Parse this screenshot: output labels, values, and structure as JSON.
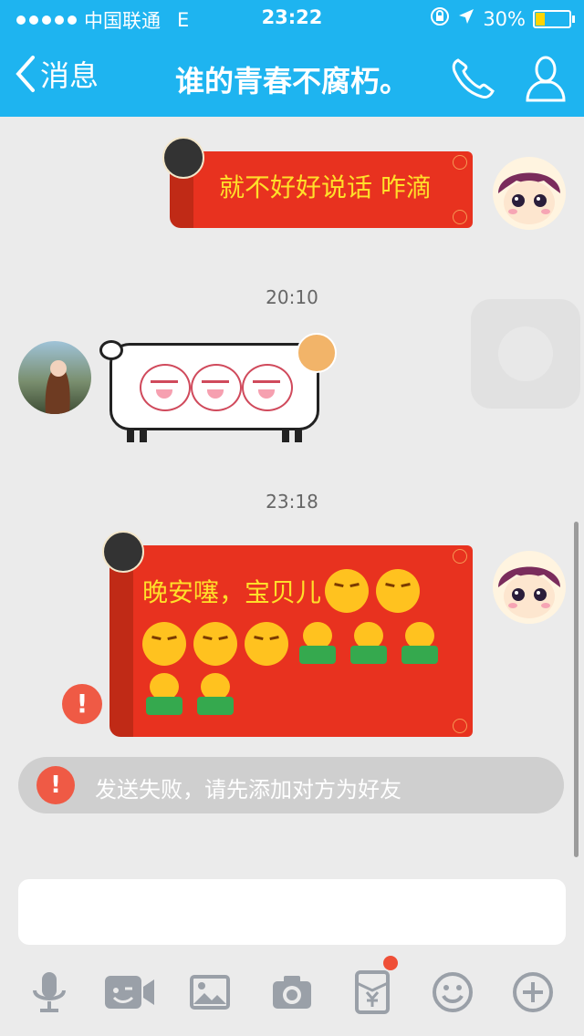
{
  "status_bar": {
    "carrier": "中国联通",
    "network": "E",
    "time": "23:22",
    "battery": "30%",
    "battery_level": 0.3
  },
  "nav": {
    "back_label": "消息",
    "title": "谁的青春不腐朽。"
  },
  "messages": {
    "msg1_text": "就不好好说话 咋滴",
    "ts1": "20:10",
    "ts2": "23:18",
    "msg2_line1": "晚安噻，宝贝儿",
    "warn_glyph": "!"
  },
  "system": {
    "failed_text": "发送失败，请先添加对方为好友",
    "icon_glyph": "!"
  },
  "input": {
    "placeholder": ""
  },
  "toolbar": {
    "badge_on_red_packet": true
  },
  "colors": {
    "brand": "#1eb4f0",
    "bubble_red": "#e8321f",
    "bubble_text": "#ffdf2a",
    "warn": "#ef5a45"
  }
}
